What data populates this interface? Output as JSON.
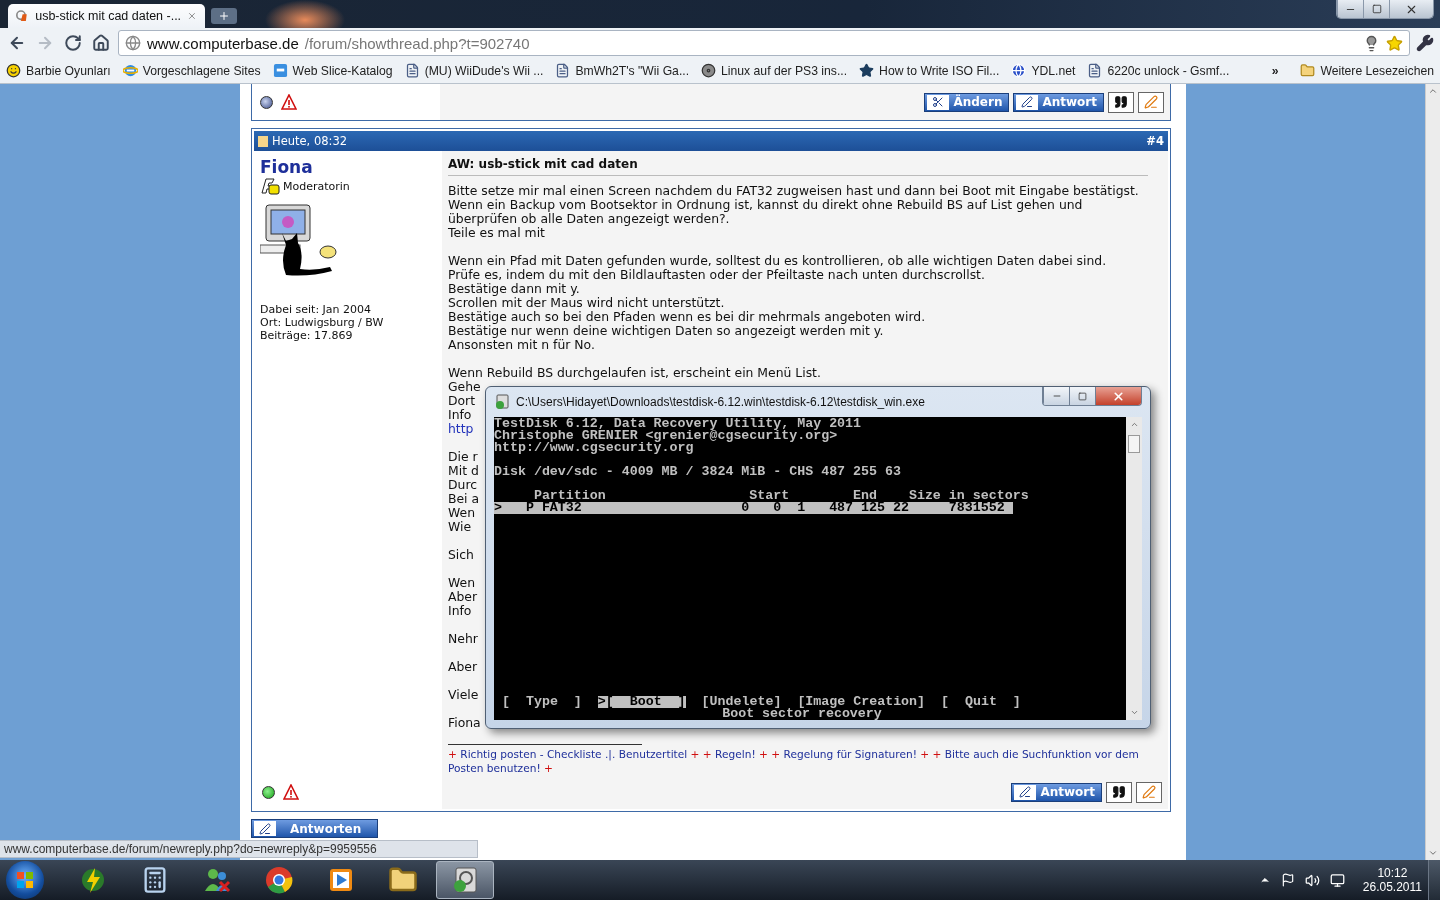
{
  "browser": {
    "tab_title": "usb-stick mit cad daten -...",
    "nav": [
      {
        "kind": "back",
        "disabled": false
      },
      {
        "kind": "forward",
        "disabled": true
      },
      {
        "kind": "reload",
        "disabled": false
      },
      {
        "kind": "home",
        "disabled": false
      }
    ],
    "url_host": "www.computerbase.de",
    "url_path": "/forum/showthread.php?t=902740",
    "bookmarks": [
      {
        "kind": "smiley",
        "label": "Barbie Oyunları"
      },
      {
        "kind": "ie",
        "label": "Vorgeschlagene Sites"
      },
      {
        "kind": "webslice",
        "label": "Web Slice-Katalog"
      },
      {
        "kind": "page",
        "label": "(MU) WiiDude's Wii ..."
      },
      {
        "kind": "page",
        "label": "BmWh2T's \"Wii Ga..."
      },
      {
        "kind": "disc",
        "label": "Linux auf der PS3 ins..."
      },
      {
        "kind": "star",
        "label": "How to Write ISO Fil..."
      },
      {
        "kind": "globe",
        "label": "YDL.net"
      },
      {
        "kind": "page",
        "label": "6220c unlock - Gsmf..."
      }
    ],
    "bookmarks_overflow": "»",
    "other_bookmarks": "Weitere Lesezeichen"
  },
  "previous_post": {
    "online": false,
    "buttons": [
      {
        "kind": "edit",
        "label": "Ändern"
      },
      {
        "kind": "reply",
        "label": "Antwort"
      }
    ]
  },
  "post": {
    "date": "Heute, 08:32",
    "number": "#4",
    "author": "Fiona",
    "rank": "Moderatorin",
    "user_info": [
      "Dabei seit: Jan 2004",
      "Ort: Ludwigsburg / BW",
      "Beiträge: 17.869"
    ],
    "title": "AW: usb-stick mit cad daten",
    "paragraphs": [
      [
        {
          "kind": "text",
          "text": "Bitte setze mir mal einen Screen nachdem du FAT32 zugweisen hast und dann bei Boot mit Eingabe bestätigst."
        },
        {
          "kind": "text",
          "text": "Wenn ein Backup vom Bootsektor in Ordnung ist, kannst du direkt ohne Rebuild BS auf List gehen und"
        },
        {
          "kind": "text",
          "text": "überprüfen ob alle Daten angezeigt werden?."
        },
        {
          "kind": "text",
          "text": "Teile es mal mit"
        }
      ],
      [
        {
          "kind": "text",
          "text": "Wenn ein Pfad mit Daten gefunden wurde, solltest du es kontrollieren, ob alle wichtigen Daten dabei sind."
        },
        {
          "kind": "text",
          "text": "Prüfe es, indem du mit den Bildlauftasten oder der Pfeiltaste nach unten durchscrollst."
        },
        {
          "kind": "text",
          "text": "Bestätige dann mit y."
        },
        {
          "kind": "text",
          "text": "Scrollen mit der Maus wird nicht unterstützt."
        },
        {
          "kind": "text",
          "text": "Bestätige auch so bei den Pfaden wenn es bei dir mehrmals angeboten wird."
        },
        {
          "kind": "text",
          "text": "Bestätige nur wenn deine wichtigen Daten so angezeigt werden mit y."
        },
        {
          "kind": "text",
          "text": "Ansonsten mit n für No."
        }
      ],
      [
        {
          "kind": "text",
          "text": "Wenn Rebuild BS durchgelaufen ist, erscheint ein Menü List."
        },
        {
          "kind": "text",
          "text": "Gehe"
        },
        {
          "kind": "text",
          "text": "Dort"
        },
        {
          "kind": "text",
          "text": "Info"
        },
        {
          "kind": "link",
          "text": "http"
        }
      ],
      [
        {
          "kind": "text",
          "text": "Die r"
        },
        {
          "kind": "text",
          "text": "Mit d"
        },
        {
          "kind": "text",
          "text": "Durc"
        },
        {
          "kind": "text",
          "text": "Bei a"
        },
        {
          "kind": "text",
          "text": "Wen"
        },
        {
          "kind": "text",
          "text": "Wie"
        }
      ],
      [
        {
          "kind": "text",
          "text": "Sich"
        }
      ],
      [
        {
          "kind": "text",
          "text": "Wen"
        },
        {
          "kind": "text",
          "text": "Aber"
        },
        {
          "kind": "text",
          "text": "Info"
        }
      ],
      [
        {
          "kind": "text",
          "text": "Nehr"
        }
      ],
      [
        {
          "kind": "text",
          "text": "Aber"
        }
      ],
      [
        {
          "kind": "text",
          "text": "Viele"
        }
      ],
      [
        {
          "kind": "text",
          "text": "Fiona"
        }
      ]
    ],
    "signature": [
      {
        "kind": "plus",
        "text": "+"
      },
      {
        "kind": "link",
        "text": "Richtig posten - Checkliste .|. Benutzertitel"
      },
      {
        "kind": "plus",
        "text": "+"
      },
      {
        "kind": "plus",
        "text": "+"
      },
      {
        "kind": "link",
        "text": "Regeln!"
      },
      {
        "kind": "plus",
        "text": "+"
      },
      {
        "kind": "plus",
        "text": "+"
      },
      {
        "kind": "link",
        "text": "Regelung für Signaturen!"
      },
      {
        "kind": "plus",
        "text": "+"
      },
      {
        "kind": "plus",
        "text": "+"
      },
      {
        "kind": "link",
        "text": "Bitte auch die Suchfunktion vor dem Posten benutzen!"
      },
      {
        "kind": "plus",
        "text": "+"
      }
    ],
    "online": true,
    "buttons": [
      {
        "kind": "reply",
        "label": "Antwort"
      }
    ]
  },
  "reply_button": "Antworten",
  "status_url": "www.computerbase.de/forum/newreply.php?do=newreply&p=9959556",
  "console": {
    "title": "C:\\Users\\Hidayet\\Downloads\\testdisk-6.12.win\\testdisk-6.12\\testdisk_win.exe",
    "header_lines": [
      "TestDisk 6.12, Data Recovery Utility, May 2011",
      "Christophe GRENIER <grenier@cgsecurity.org>",
      "http://www.cgsecurity.org"
    ],
    "disk_line": "Disk /dev/sdc - 4009 MB / 3824 MiB - CHS 487 255 63",
    "table_header": "     Partition                  Start        End    Size in sectors",
    "partitions": [
      {
        "text": ">   P FAT32                    0   0  1   487 125 22     7831552 ",
        "selected": true
      }
    ],
    "menu": [
      {
        "label": "[  Type  ]",
        "selected": false
      },
      {
        "label": ">[  Boot  ]",
        "selected": true
      },
      {
        "label": "[Undelete]",
        "selected": false
      },
      {
        "label": "[Image Creation]",
        "selected": false
      },
      {
        "label": "[  Quit  ]",
        "selected": false
      }
    ],
    "status": "Boot sector recovery"
  },
  "taskbar": {
    "apps": [
      {
        "kind": "ftp",
        "selected": false
      },
      {
        "kind": "calculator",
        "selected": false
      },
      {
        "kind": "messenger",
        "selected": false
      },
      {
        "kind": "chrome",
        "selected": false
      },
      {
        "kind": "media",
        "selected": false
      },
      {
        "kind": "explorer",
        "selected": false
      },
      {
        "kind": "testdisk",
        "selected": true
      }
    ],
    "time": "10:12",
    "date": "26.05.2011"
  }
}
